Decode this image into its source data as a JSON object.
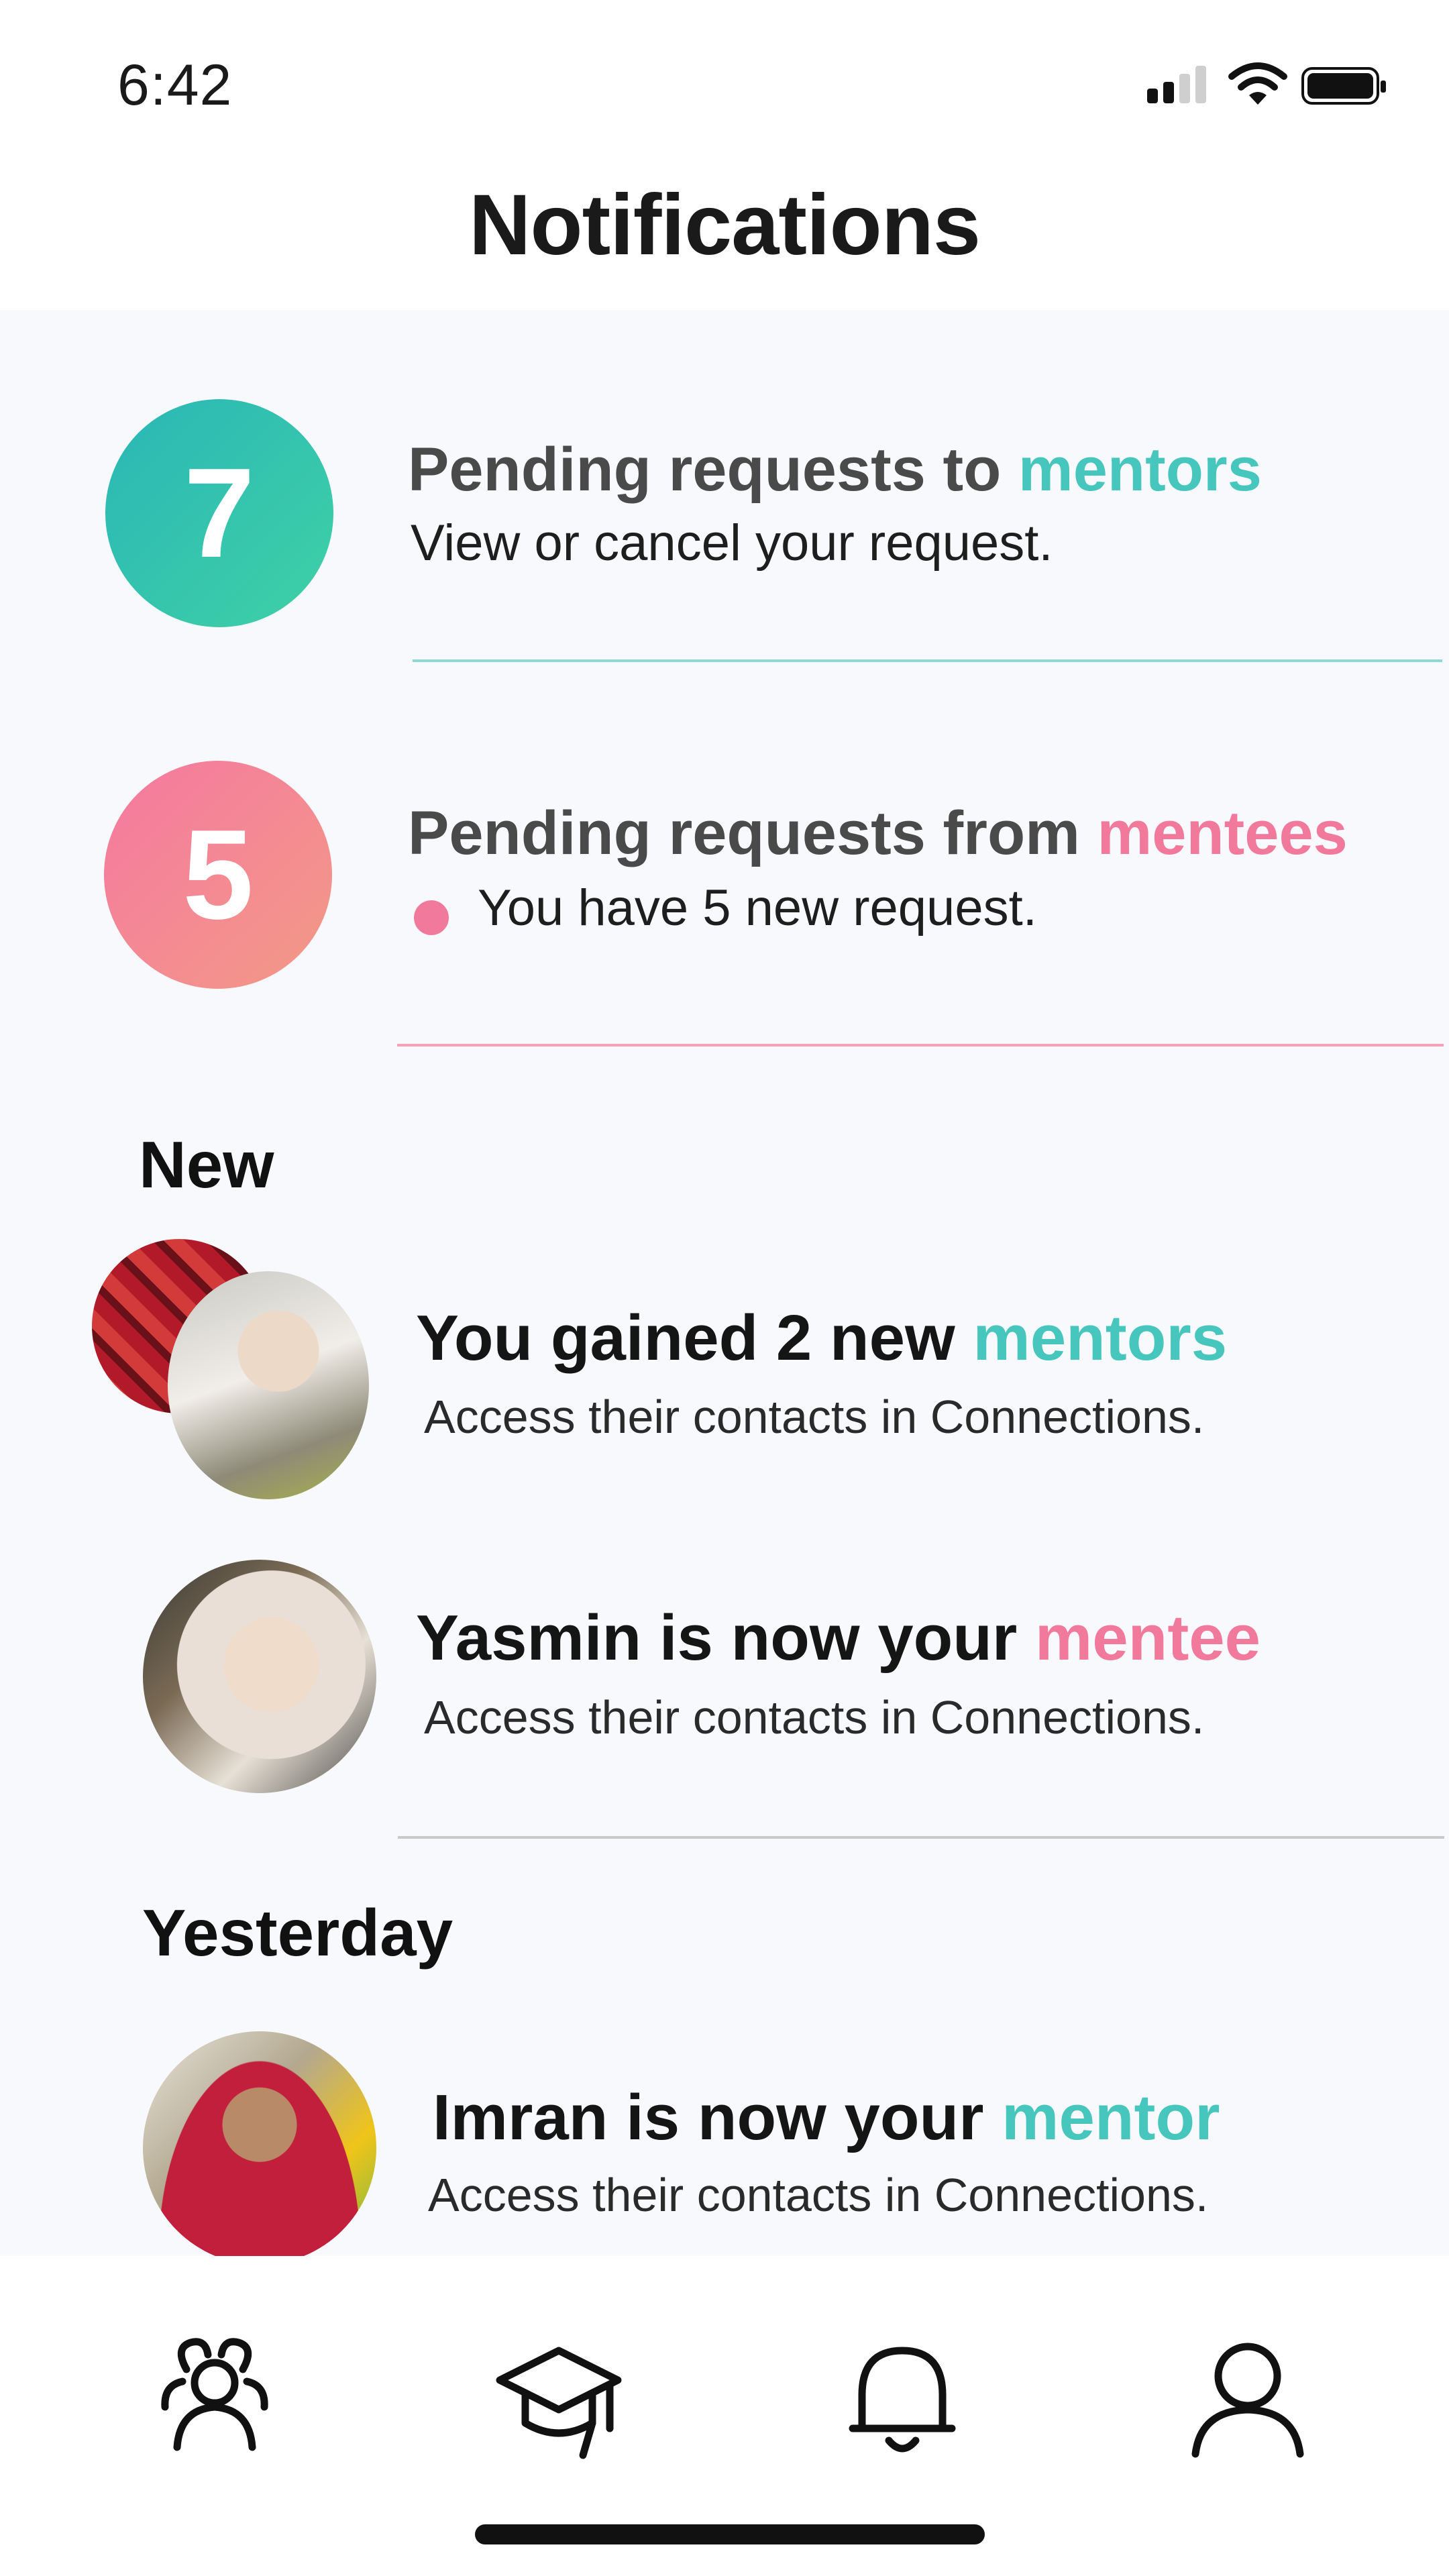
{
  "status_bar": {
    "time": "6:42"
  },
  "page": {
    "title": "Notifications"
  },
  "summary": [
    {
      "count": "7",
      "title_prefix": "Pending requests to ",
      "title_highlight": "mentors",
      "subtitle": "View or cancel your request.",
      "accent": "#46c6bd"
    },
    {
      "count": "5",
      "title_prefix": "Pending requests from ",
      "title_highlight": "mentees",
      "subtitle": "You have 5 new request.",
      "accent": "#f17a9c"
    }
  ],
  "sections": {
    "new": {
      "heading": "New",
      "items": [
        {
          "title_prefix": "You gained 2 new ",
          "title_highlight": "mentors",
          "subtitle": "Access their contacts in Connections."
        },
        {
          "title_prefix": "Yasmin is now your ",
          "title_highlight": "mentee",
          "subtitle": "Access their contacts in Connections."
        }
      ]
    },
    "yesterday": {
      "heading": "Yesterday",
      "items": [
        {
          "title_prefix": "Imran is now your ",
          "title_highlight": "mentor",
          "subtitle": "Access their contacts in Connections."
        }
      ]
    }
  },
  "tabbar": {
    "items": [
      {
        "icon": "people-icon"
      },
      {
        "icon": "graduation-cap-icon"
      },
      {
        "icon": "bell-icon"
      },
      {
        "icon": "profile-icon"
      }
    ]
  },
  "colors": {
    "teal": "#46c6bd",
    "pink": "#f17a9c",
    "background": "#f8f9fc"
  }
}
